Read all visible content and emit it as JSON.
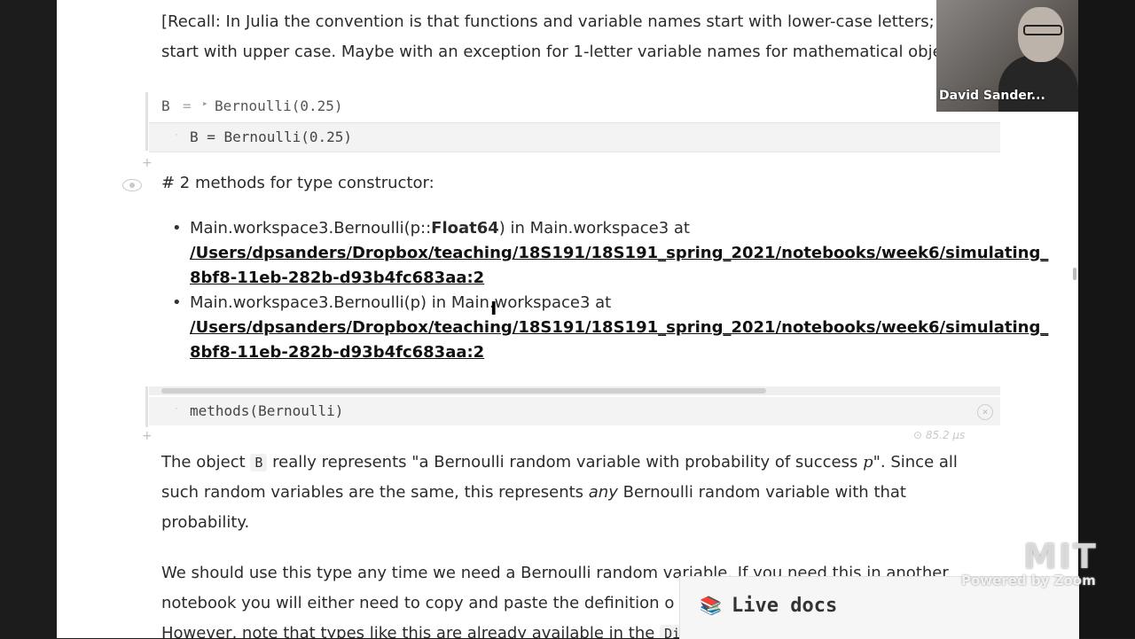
{
  "recall": {
    "line1": "[Recall: In Julia the convention is that functions and variable names start with lower-case letters;",
    "line2": "start with upper case. Maybe with an exception for 1-letter variable names for mathematical obje"
  },
  "cell_b": {
    "output_var": "B",
    "output_eq": "=",
    "output_arrow": "▸",
    "output_value": "Bernoulli(0.25)",
    "input_code": "B = Bernoulli(0.25)"
  },
  "methods_output": {
    "title": "# 2 methods for type constructor:",
    "items": [
      {
        "signature_prefix": "Main.workspace3.Bernoulli(p::",
        "signature_bold": "Float64",
        "signature_suffix": ") in Main.workspace3 at",
        "path1": "/Users/dpsanders/Dropbox/teaching/18S191/18S191_spring_2021/notebooks/week6/simulating_",
        "path2": "8bf8-11eb-282b-d93b4fc683aa:2"
      },
      {
        "signature_prefix": "Main.workspace3.Bernoulli(p)",
        "signature_bold": "",
        "signature_suffix": " in Main.workspace3 at",
        "path1": "/Users/dpsanders/Dropbox/teaching/18S191/18S191_spring_2021/notebooks/week6/simulating_",
        "path2": "8bf8-11eb-282b-d93b4fc683aa:2"
      }
    ],
    "input_code": "methods(Bernoulli)",
    "runtime": "85.2 μs"
  },
  "para1": {
    "l1_a": "The object ",
    "l1_code": "B",
    "l1_b": " really represents \"a Bernoulli random variable with probability of success ",
    "l1_p": "p",
    "l1_c": "\". Since all",
    "l2_a": "such random variables are the same, this represents ",
    "l2_em": "any",
    "l2_b": " Bernoulli random variable with that",
    "l3": "probability."
  },
  "para2": {
    "l1": "We should use this type any time we need a Bernoulli random variable. If you need this in another",
    "l2": "notebook you will either need to copy and paste the definition o",
    "l3_a": "However, note that types like this are already available in the ",
    "l3_code": "Di"
  },
  "livedocs": {
    "icon": "📚",
    "label": "Live docs"
  },
  "webcam": {
    "name": "David Sander..."
  },
  "zoom": {
    "logo": "MIT",
    "powered": "Powered by Zoom"
  }
}
